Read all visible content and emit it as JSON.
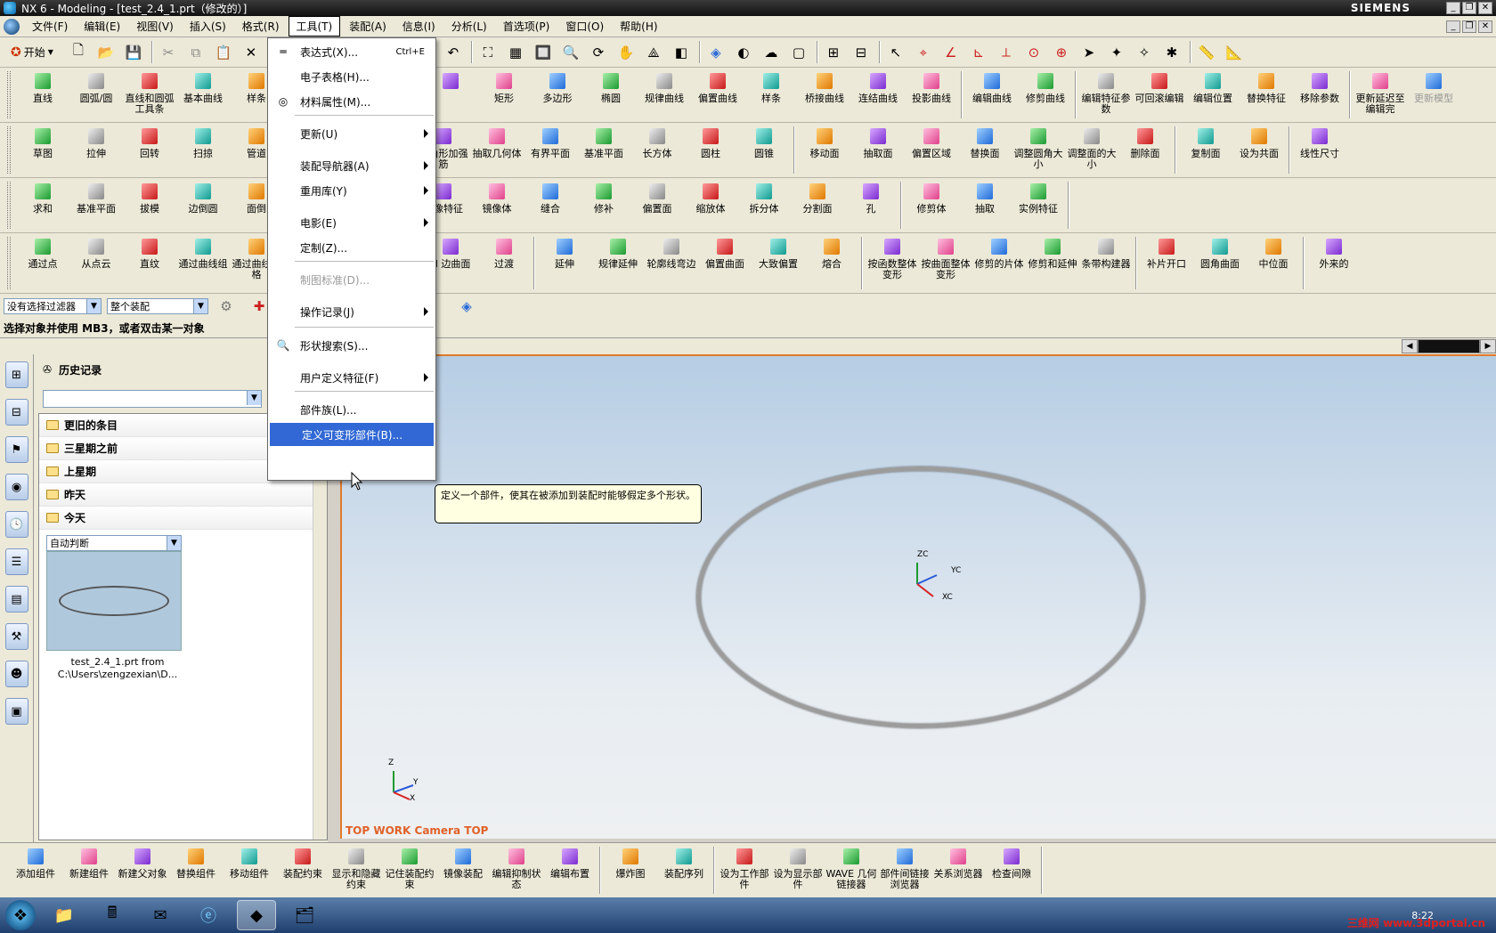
{
  "window": {
    "title": "NX 6 - Modeling - [test_2.4_1.prt（修改的）]",
    "brand": "SIEMENS"
  },
  "menubar": {
    "items": [
      "文件(F)",
      "编辑(E)",
      "视图(V)",
      "插入(S)",
      "格式(R)",
      "工具(T)",
      "装配(A)",
      "信息(I)",
      "分析(L)",
      "首选项(P)",
      "窗口(O)",
      "帮助(H)"
    ],
    "active_index": 5
  },
  "standard_toolbar": {
    "start_label": "开始"
  },
  "toolbars": {
    "row1": [
      "直线",
      "圆弧/圆",
      "直线和圆弧工具条",
      "基本曲线",
      "样条",
      "",
      "矩形",
      "多边形",
      "椭圆",
      "规律曲线",
      "偏置曲线",
      "样条",
      "桥接曲线",
      "连结曲线",
      "投影曲线",
      "编辑曲线",
      "修剪曲线",
      "编辑特征参数",
      "可回滚编辑",
      "编辑位置",
      "替换特征",
      "移除参数",
      "更新延迟至编辑完",
      "更新模型"
    ],
    "row2": [
      "草图",
      "拉伸",
      "回转",
      "扫掠",
      "管道",
      "三角形加强筋",
      "抽取几何体",
      "有界平面",
      "基准平面",
      "长方体",
      "圆柱",
      "圆锥",
      "移动面",
      "抽取面",
      "偏置区域",
      "替换面",
      "调整圆角大小",
      "调整面的大小",
      "删除面",
      "复制面",
      "设为共面",
      "线性尺寸"
    ],
    "row3": [
      "求和",
      "基准平面",
      "拔模",
      "边倒圆",
      "面倒",
      "镜像特征",
      "镜像体",
      "缝合",
      "修补",
      "偏置面",
      "缩放体",
      "拆分体",
      "分割面",
      "孔",
      "修剪体",
      "抽取",
      "实例特征"
    ],
    "row4": [
      "通过点",
      "从点云",
      "直纹",
      "通过曲线组",
      "通过曲线网格",
      "N 边曲面",
      "过渡",
      "延伸",
      "规律延伸",
      "轮廓线弯边",
      "偏置曲面",
      "大致偏置",
      "熔合",
      "按函数整体变形",
      "按曲面整体变形",
      "修剪的片体",
      "修剪和延伸",
      "条带构建器",
      "补片开口",
      "圆角曲面",
      "中位面",
      "外来的"
    ]
  },
  "selection_bar": {
    "filter": "没有选择过滤器",
    "scope": "整个装配"
  },
  "cue_line": "选择对象并使用 MB3，或者双击某一对象",
  "history_panel": {
    "title": "历史记录",
    "folders": [
      "更旧的条目",
      "三星期之前",
      "上星期",
      "昨天",
      "今天"
    ],
    "thumb_combo": "自动判断",
    "file_caption_1": "test_2.4_1.prt from",
    "file_caption_2": "C:\\Users\\zengzexian\\D..."
  },
  "viewport": {
    "label": "TOP WORK Camera TOP",
    "axis_labels": {
      "z": "ZC",
      "y": "YC",
      "x": "XC"
    },
    "mini_axis": {
      "z": "Z",
      "y": "Y",
      "x": "X"
    }
  },
  "tools_menu": {
    "items": [
      {
        "label": "表达式(X)...",
        "shortcut": "Ctrl+E",
        "icon": "equals-icon"
      },
      {
        "label": "电子表格(H)..."
      },
      {
        "label": "材料属性(M)...",
        "icon": "material-icon"
      },
      {
        "label": "更新(U)",
        "submenu": true
      },
      {
        "label": "装配导航器(A)",
        "submenu": true
      },
      {
        "label": "重用库(Y)",
        "submenu": true
      },
      {
        "label": "电影(E)",
        "submenu": true
      },
      {
        "label": "定制(Z)..."
      },
      {
        "label": "制图标准(D)...",
        "disabled": true
      },
      {
        "label": "操作记录(J)",
        "submenu": true
      },
      {
        "label": "形状搜索(S)...",
        "icon": "shape-search-icon"
      },
      {
        "label": "用户定义特征(F)",
        "submenu": true
      },
      {
        "label": "部件族(L)..."
      },
      {
        "label": "定义可变形部件(B)...",
        "highlighted": true
      }
    ]
  },
  "tooltip": "定义一个部件，使其在被添加到装配时能够假定多个形状。",
  "assembly_toolbar": [
    "添加组件",
    "新建组件",
    "新建父对象",
    "替换组件",
    "移动组件",
    "装配约束",
    "显示和隐藏约束",
    "记住装配约束",
    "镜像装配",
    "编辑抑制状态",
    "编辑布置",
    "爆炸图",
    "装配序列",
    "设为工作部件",
    "设为显示部件",
    "WAVE 几何链接器",
    "部件间链接浏览器",
    "关系浏览器",
    "检查间隙"
  ],
  "taskbar": {
    "time": "8:22"
  },
  "watermark": "三维网 www.3dportal.cn"
}
